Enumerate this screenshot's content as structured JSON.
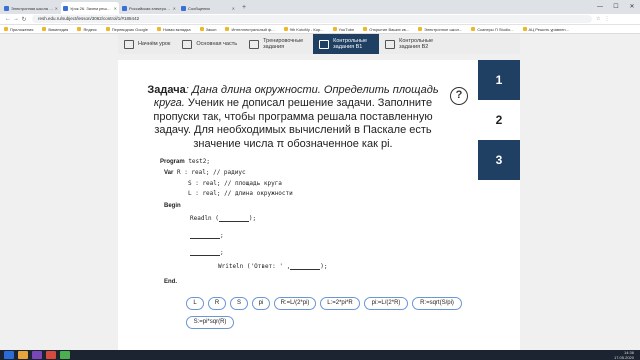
{
  "browser": {
    "tabs": [
      {
        "label": "Электронная школа - Личный",
        "active": false
      },
      {
        "label": "Урок 26. Зачем решенные с",
        "active": true
      },
      {
        "label": "Российская электронная шко",
        "active": false
      },
      {
        "label": "Сообщения",
        "active": false
      }
    ],
    "new_tab": "+",
    "url": "resh.edu.ru/subject/lesson/3062/control/1/#188442",
    "bookmarks": [
      "Приложения",
      "Википедия",
      "Яндекс",
      "Переводчик Google",
      "Новая вкладка",
      "Закон",
      "Интеллектуальный ф...",
      "9th KotoMy - Кор...",
      "YouTube",
      "Открытие Ваших кв...",
      "Электронное школ...",
      "Сканеры П Studio...",
      "АЦ Решить уравнен..."
    ]
  },
  "lesson_nav": [
    {
      "label": "Начнём урок",
      "active": false
    },
    {
      "label": "Основная часть",
      "active": false
    },
    {
      "label": "Тренировочные задания",
      "active": false
    },
    {
      "label": "Контрольные задания В1",
      "active": true
    },
    {
      "label": "Контрольные задания В2",
      "active": false
    }
  ],
  "task_tabs": [
    "1",
    "2",
    "3"
  ],
  "help": "?",
  "task": {
    "prefix": "Задача",
    "condition": ": Дана длина окружности. Определить площадь круга.",
    "instruction": "Ученик не дописал решение задачи. Заполните пропуски так, чтобы программа решала поставленную задачу. Для необходимых вычислений в Паскале есть значение числа π обозначенное как pi."
  },
  "code": {
    "program_kw": "Program",
    "program_name": "test2;",
    "var_kw": "Var",
    "var_r": "R : real; // радиус",
    "var_s": "S : real; // площадь круга",
    "var_l": "L : real; // длина окружности",
    "begin_kw": "Begin",
    "readln_pre": "Readln (",
    "readln_post": ");",
    "semi1": ";",
    "semi2": ";",
    "writeln_pre": "Writeln ('Ответ: ' ,",
    "writeln_post": ");",
    "end_kw": "End."
  },
  "options": [
    "L",
    "R",
    "S",
    "pi",
    "R:=L/(2*pi)",
    "L:=2*pi*R",
    "pi:=L/(2*R)",
    "R:=sqrt(S/pi)",
    "S:=pi*sqr(R)"
  ],
  "taskbar": {
    "time": "14:36",
    "date": "17.05.2020"
  },
  "colors": {
    "accent": "#1f3f63",
    "chip_border": "#6a96d8"
  }
}
